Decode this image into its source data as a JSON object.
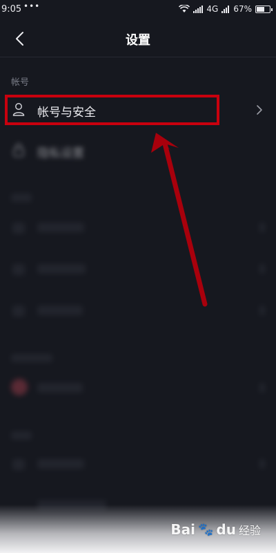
{
  "status_bar": {
    "time": "9:05",
    "dots": "•••",
    "network": "4G",
    "battery": "67%",
    "battery_level": 0.67
  },
  "header": {
    "title": "设置"
  },
  "sections": {
    "account": {
      "label": "帐号",
      "items": [
        {
          "label": "帐号与安全",
          "icon": "user-icon"
        },
        {
          "label": "隐私设置",
          "icon": "lock-icon"
        }
      ]
    }
  },
  "watermark": {
    "text": "Bai",
    "suffix": "du",
    "jingyan": "经验"
  },
  "colors": {
    "background": "#16181f",
    "highlight": "#c8000e",
    "text": "#ececf0",
    "muted": "#7a7d88"
  }
}
